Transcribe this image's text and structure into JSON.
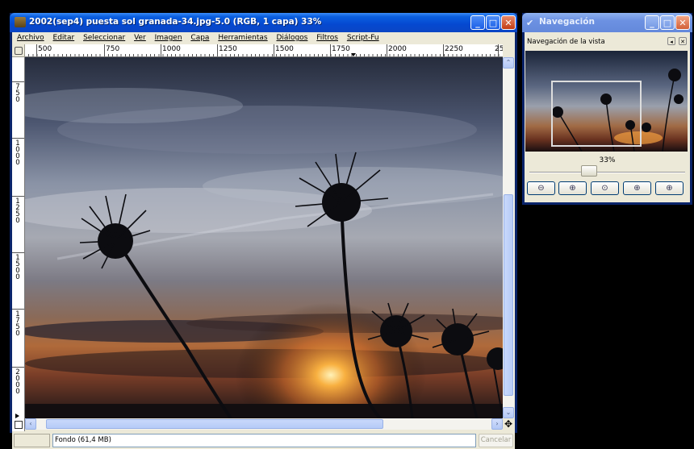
{
  "main_window": {
    "title": "2002(sep4) puesta sol granada-34.jpg-5.0 (RGB, 1 capa) 33%",
    "menus": [
      "Archivo",
      "Editar",
      "Seleccionar",
      "Ver",
      "Imagen",
      "Capa",
      "Herramientas",
      "Diálogos",
      "Filtros",
      "Script-Fu"
    ],
    "hruler_labels": [
      "500",
      "750",
      "1000",
      "1250",
      "1500",
      "1750",
      "2000",
      "2250",
      "25"
    ],
    "vruler_labels": [
      "750",
      "1000",
      "1250",
      "1500",
      "1750",
      "2000"
    ],
    "status_text": "Fondo (61,4 MB)",
    "cancel_label": "Cancelar"
  },
  "nav_window": {
    "title": "Navegación",
    "subtitle": "Navegación de la vista",
    "zoom_text": "33%"
  },
  "colors": {
    "xp_blue": "#0548d0",
    "xp_inactive_blue": "#7498e4",
    "panel_bg": "#ece9d8"
  },
  "icons": [
    "gimp-icon",
    "minimize-icon",
    "maximize-icon",
    "close-icon",
    "zoom-out-icon",
    "zoom-in-icon",
    "zoom-fit-icon",
    "shrink-icon",
    "move-icon"
  ]
}
